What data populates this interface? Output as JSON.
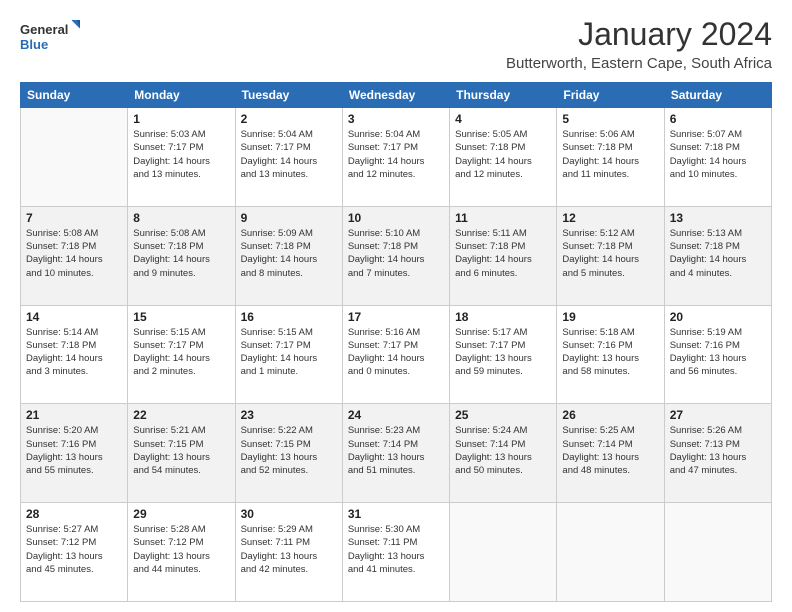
{
  "logo": {
    "line1": "General",
    "line2": "Blue"
  },
  "title": "January 2024",
  "subtitle": "Butterworth, Eastern Cape, South Africa",
  "weekdays": [
    "Sunday",
    "Monday",
    "Tuesday",
    "Wednesday",
    "Thursday",
    "Friday",
    "Saturday"
  ],
  "weeks": [
    [
      {
        "day": "",
        "info": ""
      },
      {
        "day": "1",
        "info": "Sunrise: 5:03 AM\nSunset: 7:17 PM\nDaylight: 14 hours\nand 13 minutes."
      },
      {
        "day": "2",
        "info": "Sunrise: 5:04 AM\nSunset: 7:17 PM\nDaylight: 14 hours\nand 13 minutes."
      },
      {
        "day": "3",
        "info": "Sunrise: 5:04 AM\nSunset: 7:17 PM\nDaylight: 14 hours\nand 12 minutes."
      },
      {
        "day": "4",
        "info": "Sunrise: 5:05 AM\nSunset: 7:18 PM\nDaylight: 14 hours\nand 12 minutes."
      },
      {
        "day": "5",
        "info": "Sunrise: 5:06 AM\nSunset: 7:18 PM\nDaylight: 14 hours\nand 11 minutes."
      },
      {
        "day": "6",
        "info": "Sunrise: 5:07 AM\nSunset: 7:18 PM\nDaylight: 14 hours\nand 10 minutes."
      }
    ],
    [
      {
        "day": "7",
        "info": "Sunrise: 5:08 AM\nSunset: 7:18 PM\nDaylight: 14 hours\nand 10 minutes."
      },
      {
        "day": "8",
        "info": "Sunrise: 5:08 AM\nSunset: 7:18 PM\nDaylight: 14 hours\nand 9 minutes."
      },
      {
        "day": "9",
        "info": "Sunrise: 5:09 AM\nSunset: 7:18 PM\nDaylight: 14 hours\nand 8 minutes."
      },
      {
        "day": "10",
        "info": "Sunrise: 5:10 AM\nSunset: 7:18 PM\nDaylight: 14 hours\nand 7 minutes."
      },
      {
        "day": "11",
        "info": "Sunrise: 5:11 AM\nSunset: 7:18 PM\nDaylight: 14 hours\nand 6 minutes."
      },
      {
        "day": "12",
        "info": "Sunrise: 5:12 AM\nSunset: 7:18 PM\nDaylight: 14 hours\nand 5 minutes."
      },
      {
        "day": "13",
        "info": "Sunrise: 5:13 AM\nSunset: 7:18 PM\nDaylight: 14 hours\nand 4 minutes."
      }
    ],
    [
      {
        "day": "14",
        "info": "Sunrise: 5:14 AM\nSunset: 7:18 PM\nDaylight: 14 hours\nand 3 minutes."
      },
      {
        "day": "15",
        "info": "Sunrise: 5:15 AM\nSunset: 7:17 PM\nDaylight: 14 hours\nand 2 minutes."
      },
      {
        "day": "16",
        "info": "Sunrise: 5:15 AM\nSunset: 7:17 PM\nDaylight: 14 hours\nand 1 minute."
      },
      {
        "day": "17",
        "info": "Sunrise: 5:16 AM\nSunset: 7:17 PM\nDaylight: 14 hours\nand 0 minutes."
      },
      {
        "day": "18",
        "info": "Sunrise: 5:17 AM\nSunset: 7:17 PM\nDaylight: 13 hours\nand 59 minutes."
      },
      {
        "day": "19",
        "info": "Sunrise: 5:18 AM\nSunset: 7:16 PM\nDaylight: 13 hours\nand 58 minutes."
      },
      {
        "day": "20",
        "info": "Sunrise: 5:19 AM\nSunset: 7:16 PM\nDaylight: 13 hours\nand 56 minutes."
      }
    ],
    [
      {
        "day": "21",
        "info": "Sunrise: 5:20 AM\nSunset: 7:16 PM\nDaylight: 13 hours\nand 55 minutes."
      },
      {
        "day": "22",
        "info": "Sunrise: 5:21 AM\nSunset: 7:15 PM\nDaylight: 13 hours\nand 54 minutes."
      },
      {
        "day": "23",
        "info": "Sunrise: 5:22 AM\nSunset: 7:15 PM\nDaylight: 13 hours\nand 52 minutes."
      },
      {
        "day": "24",
        "info": "Sunrise: 5:23 AM\nSunset: 7:14 PM\nDaylight: 13 hours\nand 51 minutes."
      },
      {
        "day": "25",
        "info": "Sunrise: 5:24 AM\nSunset: 7:14 PM\nDaylight: 13 hours\nand 50 minutes."
      },
      {
        "day": "26",
        "info": "Sunrise: 5:25 AM\nSunset: 7:14 PM\nDaylight: 13 hours\nand 48 minutes."
      },
      {
        "day": "27",
        "info": "Sunrise: 5:26 AM\nSunset: 7:13 PM\nDaylight: 13 hours\nand 47 minutes."
      }
    ],
    [
      {
        "day": "28",
        "info": "Sunrise: 5:27 AM\nSunset: 7:12 PM\nDaylight: 13 hours\nand 45 minutes."
      },
      {
        "day": "29",
        "info": "Sunrise: 5:28 AM\nSunset: 7:12 PM\nDaylight: 13 hours\nand 44 minutes."
      },
      {
        "day": "30",
        "info": "Sunrise: 5:29 AM\nSunset: 7:11 PM\nDaylight: 13 hours\nand 42 minutes."
      },
      {
        "day": "31",
        "info": "Sunrise: 5:30 AM\nSunset: 7:11 PM\nDaylight: 13 hours\nand 41 minutes."
      },
      {
        "day": "",
        "info": ""
      },
      {
        "day": "",
        "info": ""
      },
      {
        "day": "",
        "info": ""
      }
    ]
  ]
}
